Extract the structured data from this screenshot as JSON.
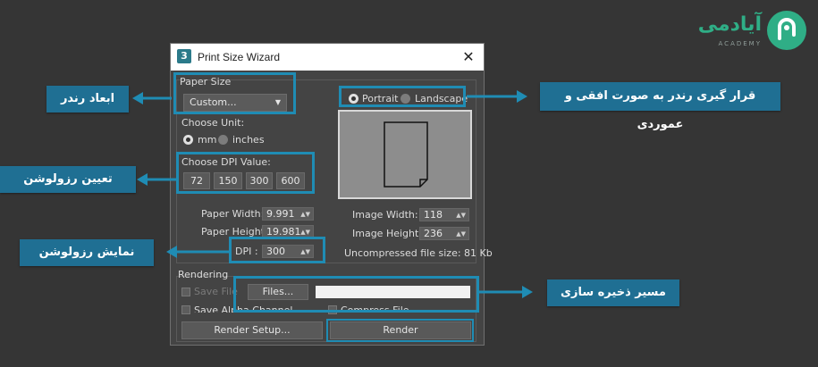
{
  "logo": {
    "text": "آیادمی",
    "sub": "ACADEMY",
    "color": "#2fae86"
  },
  "dialog": {
    "title": "Print Size Wizard",
    "icon_label": "3",
    "paper_size": {
      "label": "Paper Size",
      "selected": "Custom..."
    },
    "orientation": {
      "portrait": "Portrait",
      "landscape": "Landscape",
      "selected": "portrait"
    },
    "unit": {
      "label": "Choose Unit:",
      "mm": "mm",
      "inches": "inches",
      "selected": "mm"
    },
    "dpi_choice": {
      "label": "Choose DPI Value:",
      "values": [
        "72",
        "150",
        "300",
        "600"
      ]
    },
    "paper_width": {
      "label": "Paper Width:",
      "value": "9.991"
    },
    "paper_height": {
      "label": "Paper Height:",
      "value": "19.981"
    },
    "dpi": {
      "label": "DPI :",
      "value": "300"
    },
    "image_width": {
      "label": "Image Width:",
      "value": "118"
    },
    "image_height": {
      "label": "Image Height:",
      "value": "236"
    },
    "file_size": "Uncompressed file size: 81 Kb",
    "rendering": {
      "label": "Rendering",
      "save_file": "Save File",
      "files_button": "Files...",
      "file_path": "",
      "save_alpha": "Save Alpha Channel",
      "compress": "Compress File",
      "render_setup": "Render Setup...",
      "render": "Render"
    }
  },
  "callouts": {
    "render_dimensions": "ابعاد رندر",
    "resolution": "تعیین رزولوشن",
    "show_resolution": "نمایش رزولوشن",
    "orientation": "قرار گیری رندر به صورت افقی و عموردی",
    "save_path": "مسیر ذخیره سازی"
  },
  "colors": {
    "highlight": "#1f8cb4",
    "callout_bg": "#1f6f93",
    "background": "#353535"
  }
}
